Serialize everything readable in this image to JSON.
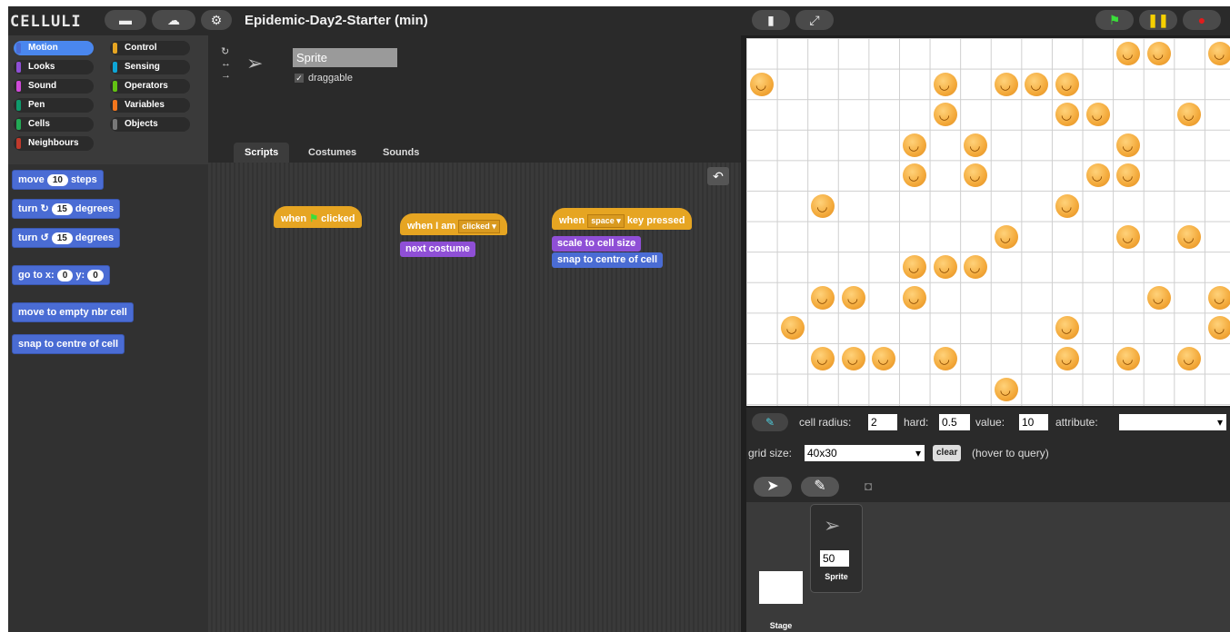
{
  "app": {
    "logo": "CELLULI",
    "project_title": "Epidemic-Day2-Starter (min)"
  },
  "categories": [
    {
      "label": "Motion",
      "color": "#4a6cd4",
      "selected": true
    },
    {
      "label": "Control",
      "color": "#e6a522"
    },
    {
      "label": "Looks",
      "color": "#8f4fd6"
    },
    {
      "label": "Sensing",
      "color": "#0ea5d6"
    },
    {
      "label": "Sound",
      "color": "#cf4ad9"
    },
    {
      "label": "Operators",
      "color": "#62c213"
    },
    {
      "label": "Pen",
      "color": "#0e9a6c"
    },
    {
      "label": "Variables",
      "color": "#f3761d"
    },
    {
      "label": "Cells",
      "color": "#22aa55"
    },
    {
      "label": "Objects",
      "color": "#777777"
    },
    {
      "label": "Neighbours",
      "color": "#c0392b"
    }
  ],
  "palette": {
    "move_pre": "move",
    "move_val": "10",
    "move_post": "steps",
    "turn_cw_pre": "turn",
    "turn_cw_val": "15",
    "turn_cw_post": "degrees",
    "turn_ccw_pre": "turn",
    "turn_ccw_val": "15",
    "turn_ccw_post": "degrees",
    "goto_pre": "go to x:",
    "goto_x": "0",
    "goto_mid": "y:",
    "goto_y": "0",
    "move_empty": "move to empty nbr cell",
    "snap": "snap to centre of cell"
  },
  "sprite": {
    "name": "Sprite",
    "draggable_label": "draggable",
    "draggable_checked": true
  },
  "tabs": [
    "Scripts",
    "Costumes",
    "Sounds"
  ],
  "scripts": {
    "hat1_pre": "when",
    "hat1_post": "clicked",
    "hat2_pre": "when I am",
    "hat2_dd": "clicked",
    "hat2_cmd": "next costume",
    "hat3_pre": "when",
    "hat3_dd": "space",
    "hat3_post": "key pressed",
    "hat3_cmd1": "scale to cell size",
    "hat3_cmd2": "snap to centre of cell"
  },
  "stage_cells": [
    [
      12,
      0
    ],
    [
      13,
      0
    ],
    [
      15,
      0
    ],
    [
      0,
      1
    ],
    [
      6,
      1
    ],
    [
      8,
      1
    ],
    [
      9,
      1
    ],
    [
      10,
      1
    ],
    [
      6,
      2
    ],
    [
      10,
      2
    ],
    [
      11,
      2
    ],
    [
      14,
      2
    ],
    [
      5,
      3
    ],
    [
      7,
      3
    ],
    [
      12,
      3
    ],
    [
      5,
      4
    ],
    [
      7,
      4
    ],
    [
      11,
      4
    ],
    [
      12,
      4
    ],
    [
      2,
      5
    ],
    [
      10,
      5
    ],
    [
      8,
      6
    ],
    [
      12,
      6
    ],
    [
      14,
      6
    ],
    [
      5,
      7
    ],
    [
      6,
      7
    ],
    [
      7,
      7
    ],
    [
      2,
      8
    ],
    [
      3,
      8
    ],
    [
      5,
      8
    ],
    [
      13,
      8
    ],
    [
      15,
      8
    ],
    [
      1,
      9
    ],
    [
      10,
      9
    ],
    [
      15,
      9
    ],
    [
      2,
      10
    ],
    [
      3,
      10
    ],
    [
      4,
      10
    ],
    [
      6,
      10
    ],
    [
      10,
      10
    ],
    [
      12,
      10
    ],
    [
      14,
      10
    ],
    [
      8,
      11
    ]
  ],
  "controls": {
    "cell_radius_label": "cell radius:",
    "cell_radius": "2",
    "hard_label": "hard:",
    "hard": "0.5",
    "value_label": "value:",
    "value": "10",
    "attribute_label": "attribute:",
    "attribute": "",
    "grid_size_label": "grid size:",
    "grid_size": "40x30",
    "clear_label": "clear",
    "hover_label": "(hover to query)"
  },
  "corral": {
    "sprite_size": "50",
    "sprite_label": "Sprite",
    "stage_label": "Stage"
  }
}
